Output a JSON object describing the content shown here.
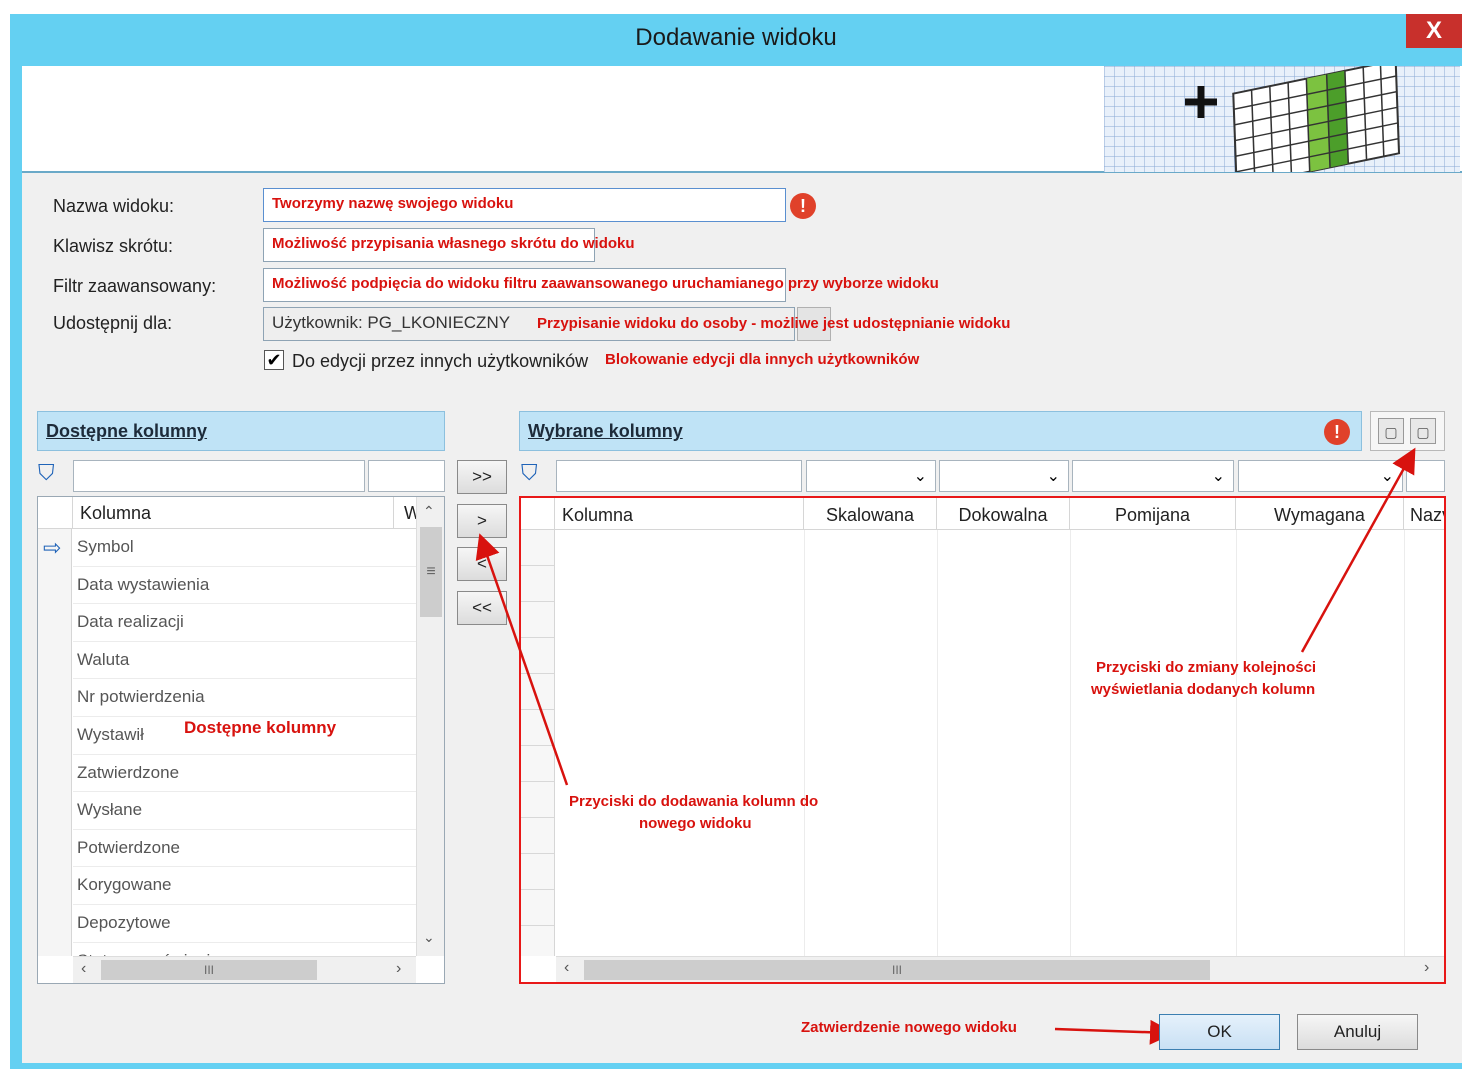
{
  "window": {
    "title": "Dodawanie widoku",
    "close_label": "X"
  },
  "form": {
    "name_label": "Nazwa widoku:",
    "name_value": "Tworzymy nazwę swojego widoku",
    "shortcut_label": "Klawisz skrótu:",
    "shortcut_value": "Możliwość przypisania własnego skrótu do widoku",
    "filter_label": "Filtr zaawansowany:",
    "filter_value": "Możliwość podpięcia do widoku filtru zaawansowanego uruchamianego przy wyborze widoku",
    "share_label": "Udostępnij dla:",
    "share_value": "Użytkownik: PG_LKONIECZNY",
    "share_note": "Przypisanie widoku do osoby - możliwe jest udostępnianie widoku",
    "edit_checkbox_label": "Do edycji przez innych użytkowników",
    "edit_checkbox_checked": true,
    "edit_note": "Blokowanie edycji dla innych użytkowników"
  },
  "available": {
    "header": "Dostępne kolumny",
    "col_header": "Kolumna",
    "col_header2": "W",
    "items": [
      "Symbol",
      "Data wystawienia",
      "Data realizacji",
      "Waluta",
      "Nr potwierdzenia",
      "Wystawił",
      "Zatwierdzone",
      "Wysłane",
      "Potwierdzone",
      "Korygowane",
      "Depozytowe",
      "Status zamówienia"
    ],
    "note": "Dostępne kolumny"
  },
  "transfer": {
    "add_all": ">>",
    "add": ">",
    "remove": "<",
    "remove_all": "<<"
  },
  "selected": {
    "header": "Wybrane kolumny",
    "columns": [
      "Kolumna",
      "Skalowana",
      "Dokowalna",
      "Pomijana",
      "Wymagana",
      "Nazwa"
    ],
    "visible_partial_column": "Nazv"
  },
  "annotations": {
    "add_buttons_note": "Przyciski do dodawania kolumn do nowego widoku",
    "add_buttons_note_line1": "Przyciski do dodawania kolumn do",
    "add_buttons_note_line2": "nowego widoku",
    "order_buttons_line1": "Przyciski do zmiany kolejności",
    "order_buttons_line2": "wyświetlania dodanych kolumn",
    "confirm_note": "Zatwierdzenie nowego widoku"
  },
  "footer": {
    "ok_label": "OK",
    "cancel_label": "Anuluj"
  },
  "icons": {
    "close": "close-icon",
    "error": "error-icon",
    "filter": "filter-icon",
    "row_pointer": "arrow-right-icon",
    "move_up": "move-up-icon",
    "move_down": "move-down-icon",
    "grid_plus": "add-grid-icon"
  },
  "colors": {
    "titlebar": "#64d0f2",
    "close": "#c8302c",
    "annotation": "#d8120e",
    "panel_header": "#bfe3f6",
    "error_icon": "#e0412a"
  },
  "scrollbar": {
    "thumb_glyph": "III",
    "grip_glyph": "≡"
  }
}
